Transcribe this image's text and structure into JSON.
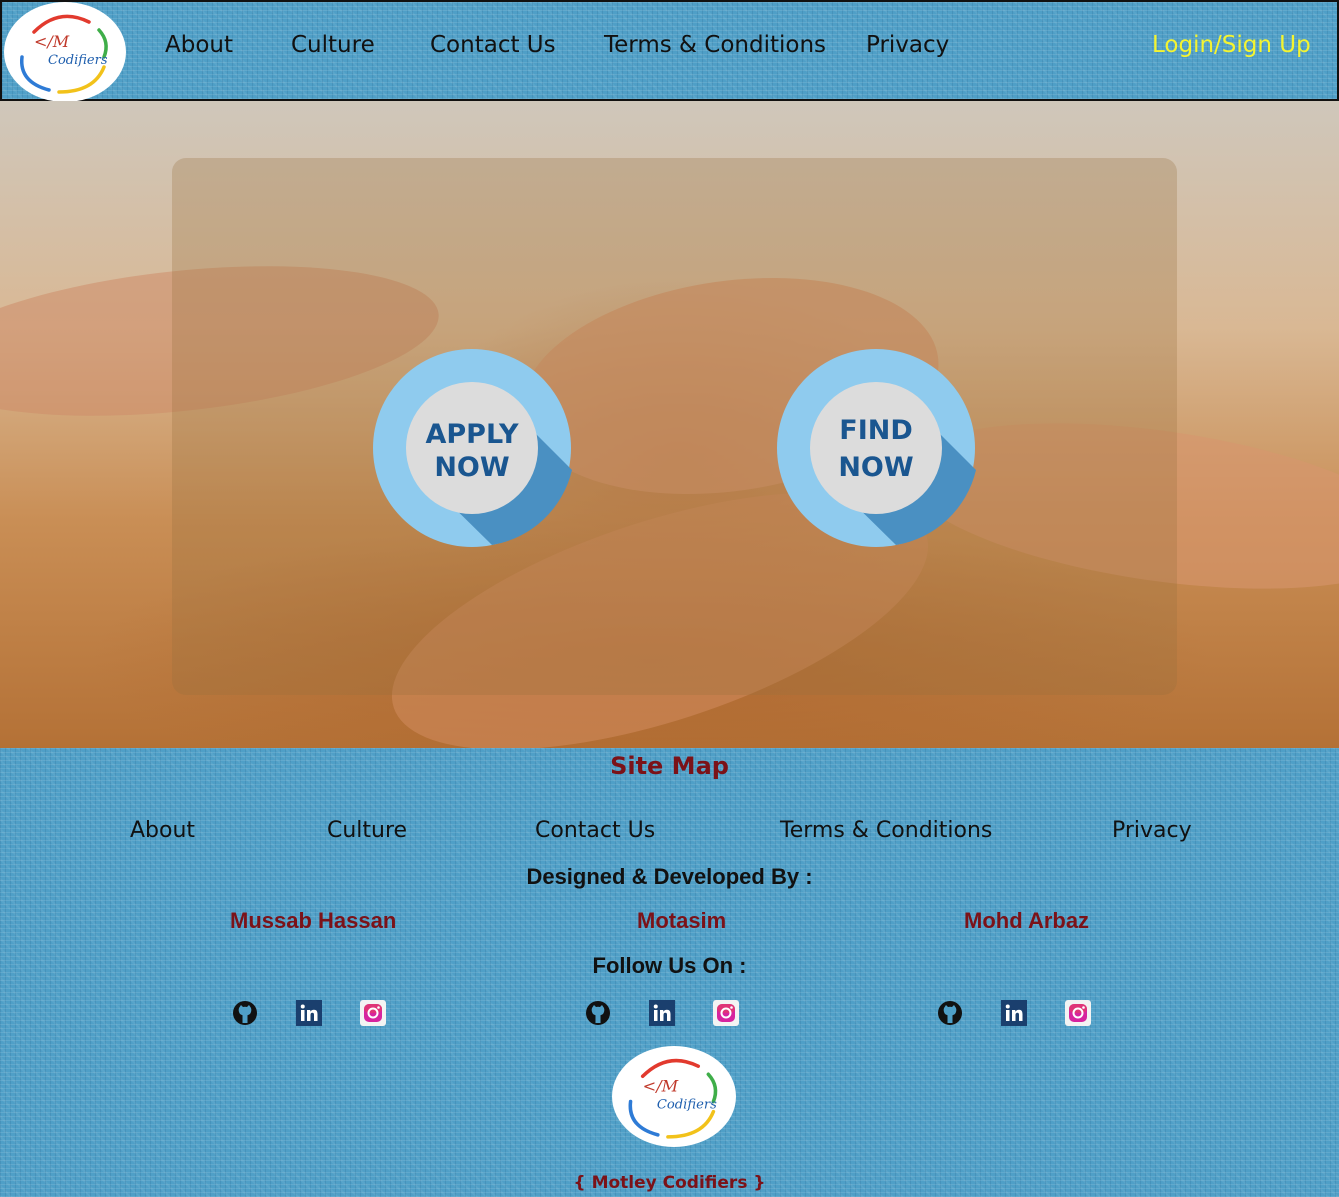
{
  "header": {
    "logo_text": "Codifiers",
    "nav": [
      "About",
      "Culture",
      "Contact Us",
      "Terms & Conditions",
      "Privacy"
    ],
    "login_label": "Login/Sign Up"
  },
  "hero": {
    "apply_button": {
      "line1": "APPLY",
      "line2": "NOW"
    },
    "find_button": {
      "line1": "FIND",
      "line2": "NOW"
    }
  },
  "footer": {
    "sitemap_title": "Site Map",
    "sitemap_links": [
      "About",
      "Culture",
      "Contact Us",
      "Terms & Conditions",
      "Privacy"
    ],
    "designed_by": "Designed & Developed By :",
    "developers": [
      "Mussab Hassan",
      "Motasim",
      "Mohd Arbaz"
    ],
    "follow_us": "Follow Us On :",
    "social_icons": [
      "github-icon",
      "linkedin-icon",
      "instagram-icon"
    ],
    "brand": "{ Motley Codifiers }"
  },
  "colors": {
    "background": "#4f9fc7",
    "login": "#f4f430",
    "accent_red": "#7b1218",
    "button_blue": "#1a5690",
    "button_ring": "#8fcbee"
  }
}
